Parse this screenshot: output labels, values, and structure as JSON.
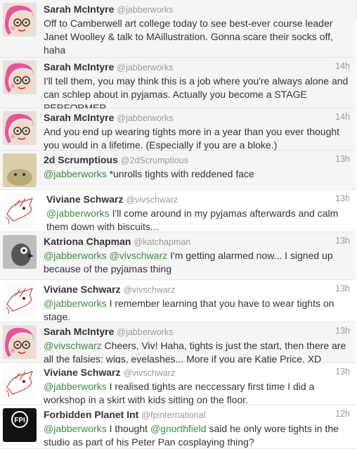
{
  "tweets": [
    {
      "name": "Sarah McIntyre",
      "handle": "@jabberworks",
      "time": "",
      "avatar": "sarah-avatar",
      "parts": [
        [
          "t",
          "Off to Camberwell art college today to see best-ever course leader Janet Woolley & talk to MAillustration. Gonna scare their socks off, haha"
        ]
      ]
    },
    {
      "name": "Sarah McIntyre",
      "handle": "@jabberworks",
      "time": "14h",
      "avatar": "sarah-avatar",
      "parts": [
        [
          "t",
          "I'll tell them, you may think this is a job where you're always alone and can schlep about in pyjamas. Actually you become a STAGE PERFORMER"
        ]
      ]
    },
    {
      "name": "Sarah McIntyre",
      "handle": "@jabberworks",
      "time": "14h",
      "avatar": "sarah-avatar",
      "parts": [
        [
          "t",
          "And you end up wearing tights more in a year than you ever thought you would in a lifetime. (Especially if you are a bloke.)"
        ]
      ]
    },
    {
      "name": "2d Scrumptious",
      "handle": "@2dScrumptious",
      "time": "13h",
      "avatar": "scrumptious-avatar",
      "parts": [
        [
          "m",
          "@jabberworks"
        ],
        [
          "t",
          " *unrolls tights with reddened face"
        ]
      ]
    },
    {
      "name": "Viviane Schwarz",
      "handle": "@vivschwarz",
      "time": "13h",
      "avatar": "viviane-avatar",
      "parts": [
        [
          "m",
          "@jabberworks"
        ],
        [
          "t",
          " I'll come around in my pyjamas afterwards and calm them down with biscuits..."
        ]
      ]
    },
    {
      "name": "Katriona Chapman",
      "handle": "@katchapman",
      "time": "13h",
      "avatar": "katriona-avatar",
      "parts": [
        [
          "m",
          "@jabberworks"
        ],
        [
          "t",
          " "
        ],
        [
          "m",
          "@vivschwarz"
        ],
        [
          "t",
          " I'm getting alarmed now... I signed up because of the pyjamas thing"
        ]
      ]
    },
    {
      "name": "Viviane Schwarz",
      "handle": "@vivschwarz",
      "time": "13h",
      "avatar": "viviane-avatar",
      "parts": [
        [
          "m",
          "@jabberworks"
        ],
        [
          "t",
          " I remember learning that you have to wear tights on stage."
        ]
      ]
    },
    {
      "name": "Sarah McIntyre",
      "handle": "@jabberworks",
      "time": "13h",
      "avatar": "sarah-avatar",
      "parts": [
        [
          "m",
          "@vivschwarz"
        ],
        [
          "t",
          " Cheers, Viv! Haha, tights is just the start, then there are all the falsies: wigs, eyelashes... More if you are Katie Price. XD"
        ]
      ]
    },
    {
      "name": "Viviane Schwarz",
      "handle": "@vivschwarz",
      "time": "13h",
      "avatar": "viviane-avatar",
      "parts": [
        [
          "m",
          "@jabberworks"
        ],
        [
          "t",
          " I realised tights are neccessary first time I did a workshop in a skirt with kids sitting on the floor."
        ]
      ]
    },
    {
      "name": "Forbidden Planet Int",
      "handle": "@fpinternational",
      "time": "12h",
      "avatar": "forbidden-planet-avatar",
      "avatar_text": "Forbidden Planet International",
      "parts": [
        [
          "m",
          "@jabberworks"
        ],
        [
          "t",
          " I thought "
        ],
        [
          "m",
          "@gnorthfield"
        ],
        [
          "t",
          " said he only wore tights in the studio as part of his Peter Pan cosplaying thing?"
        ]
      ]
    }
  ],
  "colors": {
    "mention": "#3f8b40",
    "name": "#333333",
    "meta": "#999999"
  }
}
